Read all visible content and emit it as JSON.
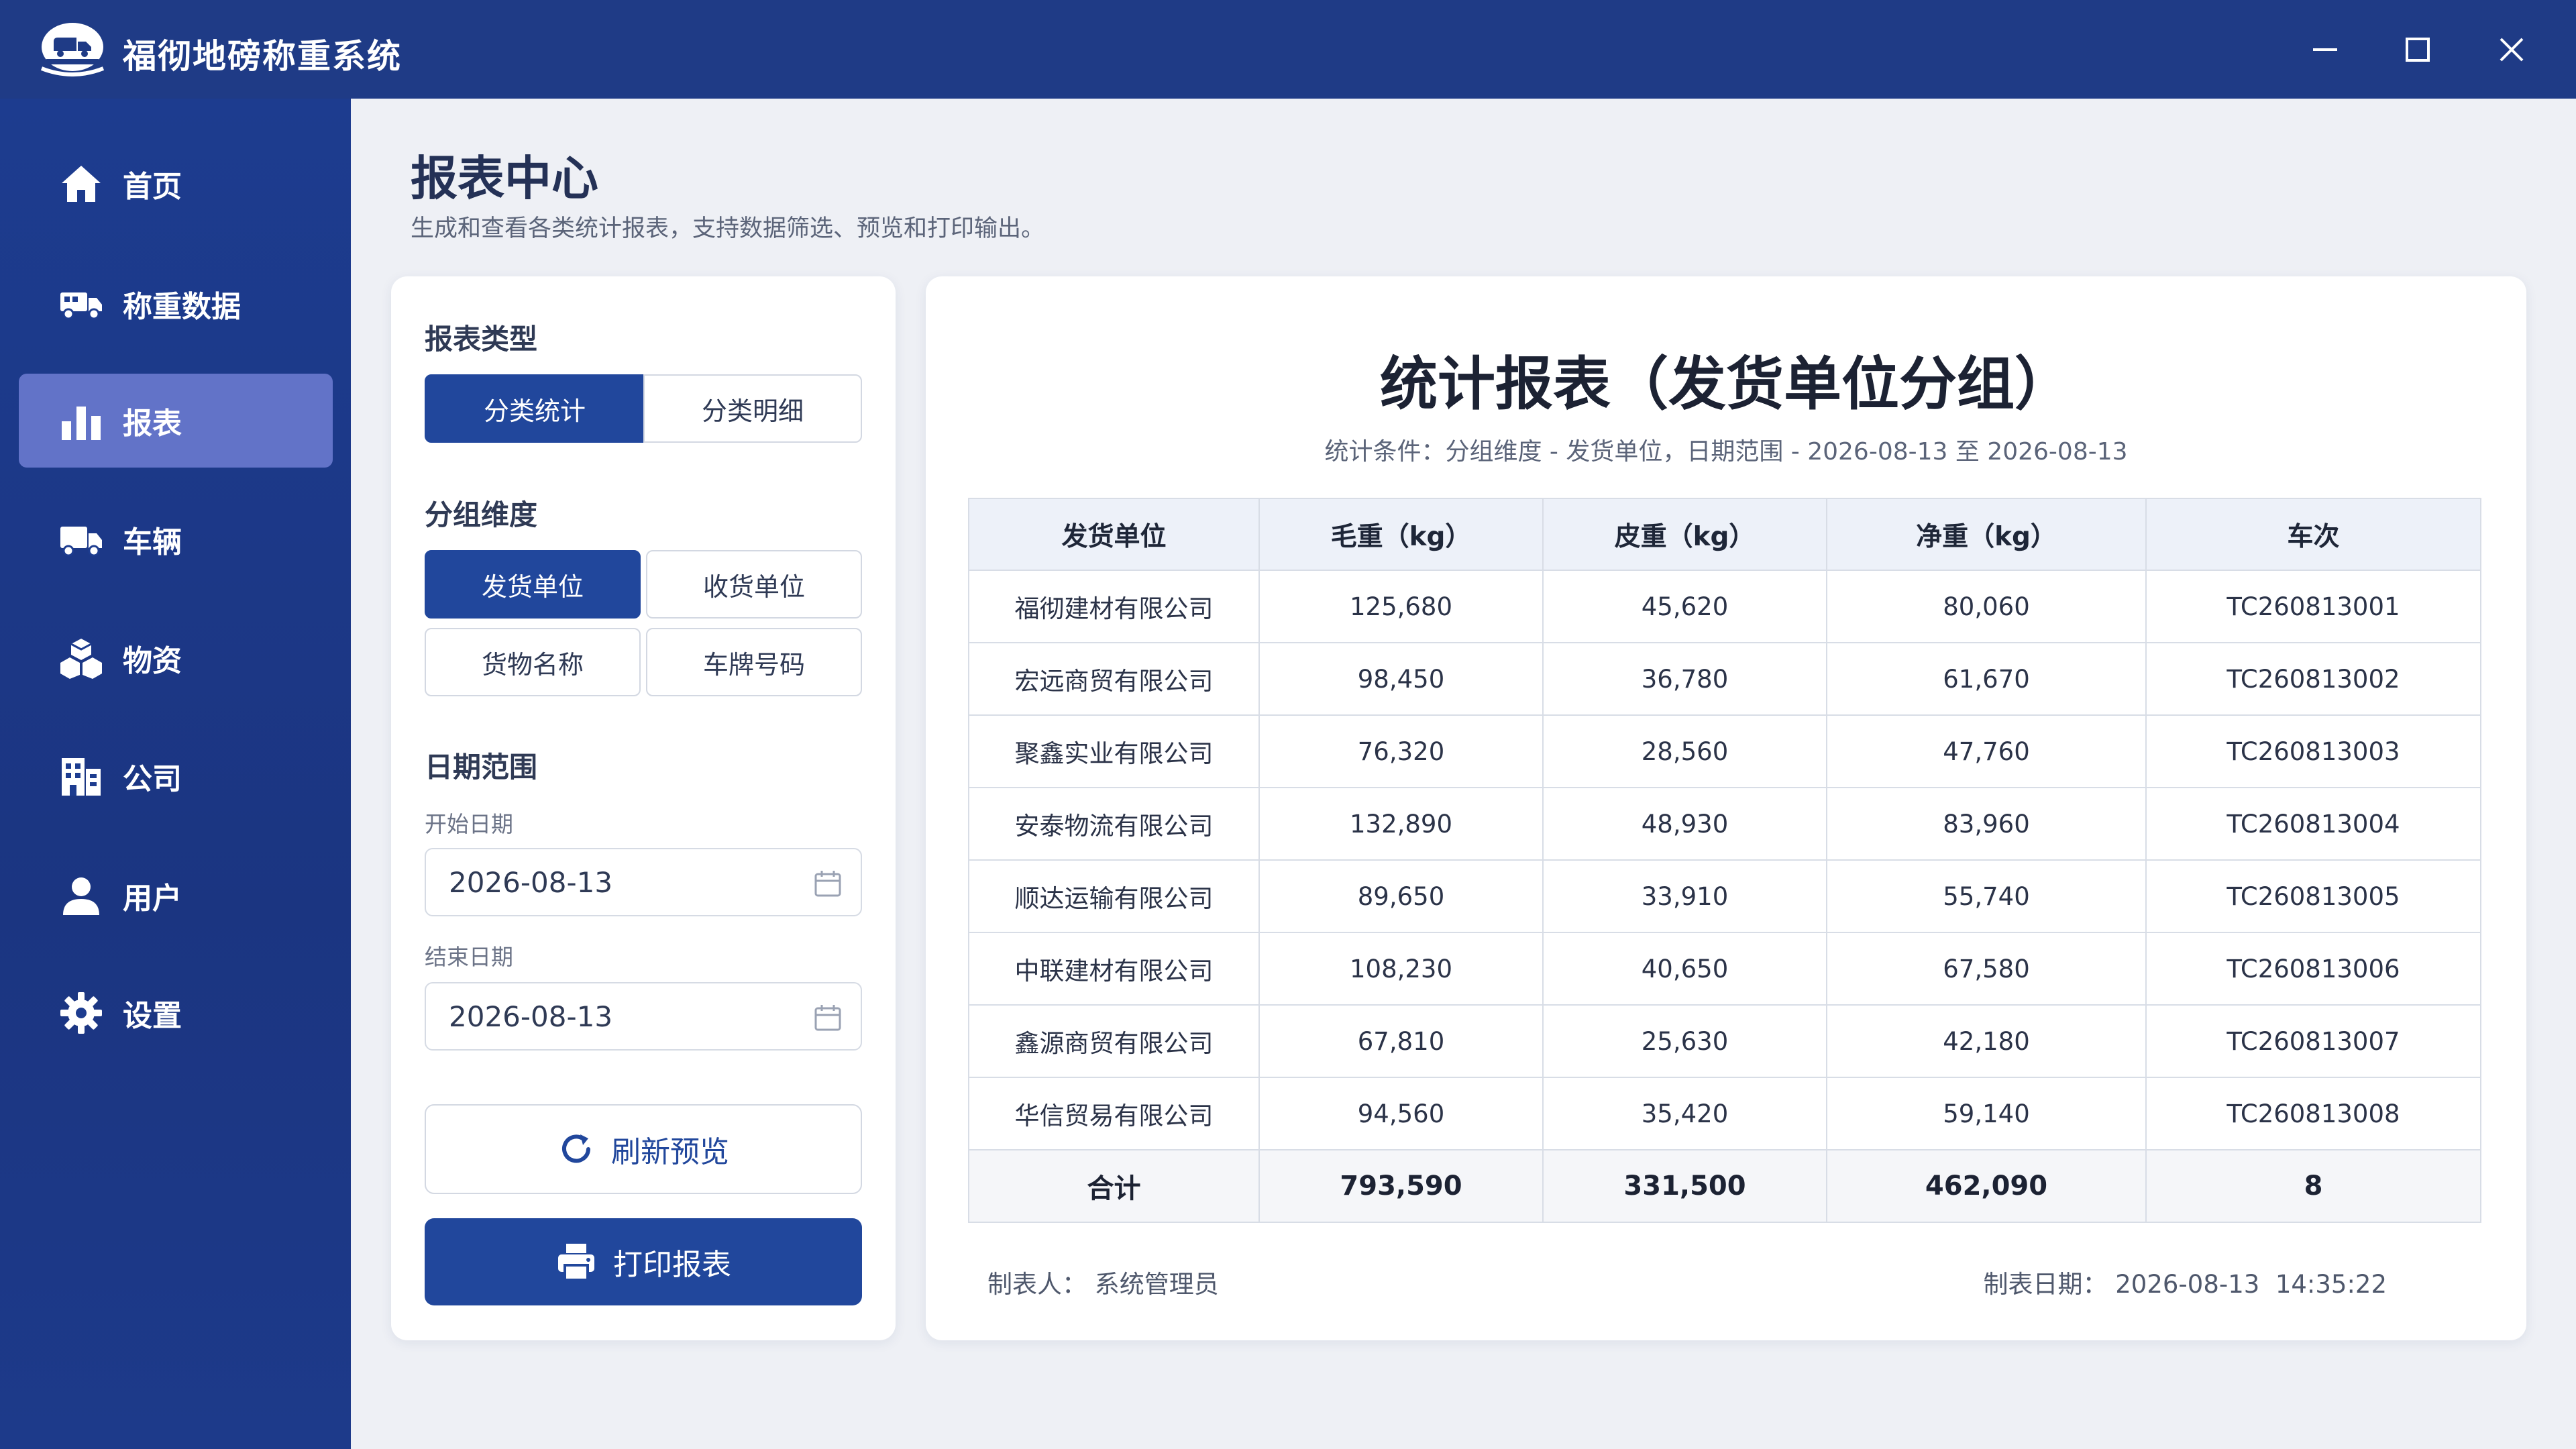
{
  "app": {
    "title": "福彻地磅称重系统",
    "logo_icon": "truck-scale-logo-icon",
    "window_controls": [
      "minimize-icon",
      "maximize-icon",
      "close-icon"
    ]
  },
  "sidebar": {
    "items": [
      {
        "label": "首页",
        "icon": "home-icon",
        "active": false
      },
      {
        "label": "称重数据",
        "icon": "truck-weigh-icon",
        "active": false
      },
      {
        "label": "报表",
        "icon": "bar-chart-icon",
        "active": true
      },
      {
        "label": "车辆",
        "icon": "truck-icon",
        "active": false
      },
      {
        "label": "物资",
        "icon": "boxes-icon",
        "active": false
      },
      {
        "label": "公司",
        "icon": "building-icon",
        "active": false
      },
      {
        "label": "用户",
        "icon": "user-icon",
        "active": false
      },
      {
        "label": "设置",
        "icon": "gear-icon",
        "active": false
      }
    ],
    "active_color": "#6273c8"
  },
  "header": {
    "title": "报表中心",
    "subtitle": "生成和查看各类统计报表，支持数据筛选、预览和打印输出。"
  },
  "filters": {
    "report_type": {
      "title": "报表类型",
      "options": [
        "分类统计",
        "分类明细"
      ],
      "selected": "分类统计"
    },
    "group_dimension": {
      "title": "分组维度",
      "options": [
        "发货单位",
        "收货单位",
        "货物名称",
        "车牌号码"
      ],
      "selected": "发货单位"
    },
    "date_range": {
      "title": "日期范围",
      "start_label": "开始日期",
      "start_value": "2026-08-13",
      "end_label": "结束日期",
      "end_value": "2026-08-13"
    },
    "refresh_label": "刷新预览",
    "print_label": "打印报表"
  },
  "report": {
    "title": "统计报表（发货单位分组）",
    "conditions": "统计条件：分组维度 - 发货单位，日期范围 - 2026-08-13 至 2026-08-13",
    "columns": [
      "发货单位",
      "毛重（kg）",
      "皮重（kg）",
      "净重（kg）",
      "车次"
    ],
    "rows": [
      [
        "福彻建材有限公司",
        "125,680",
        "45,620",
        "80,060",
        "TC260813001"
      ],
      [
        "宏远商贸有限公司",
        "98,450",
        "36,780",
        "61,670",
        "TC260813002"
      ],
      [
        "聚鑫实业有限公司",
        "76,320",
        "28,560",
        "47,760",
        "TC260813003"
      ],
      [
        "安泰物流有限公司",
        "132,890",
        "48,930",
        "83,960",
        "TC260813004"
      ],
      [
        "顺达运输有限公司",
        "89,650",
        "33,910",
        "55,740",
        "TC260813005"
      ],
      [
        "中联建材有限公司",
        "108,230",
        "40,650",
        "67,580",
        "TC260813006"
      ],
      [
        "鑫源商贸有限公司",
        "67,810",
        "25,630",
        "42,180",
        "TC260813007"
      ],
      [
        "华信贸易有限公司",
        "94,560",
        "35,420",
        "59,140",
        "TC260813008"
      ]
    ],
    "total": [
      "合计",
      "793,590",
      "331,500",
      "462,090",
      "8"
    ],
    "maker_label": "制表人：",
    "maker_value": "系统管理员",
    "date_label": "制表日期：",
    "date_value": "2026-08-13  14:35:22"
  },
  "colors": {
    "primary": "#21479c",
    "titlebar": "#1f3b86",
    "sidebar": "#1d3c8f"
  }
}
